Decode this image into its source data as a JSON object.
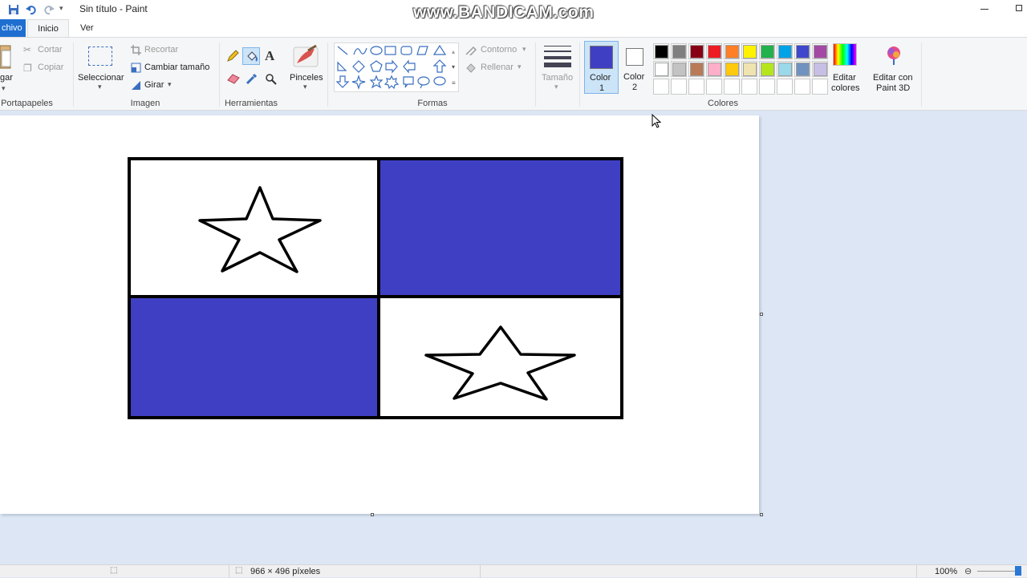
{
  "window": {
    "title": "Sin título - Paint"
  },
  "watermark": "www.BANDICAM.com",
  "tabs": {
    "file": "chivo",
    "home": "Inicio",
    "view": "Ver"
  },
  "clipboard": {
    "paste_label": "gar",
    "cut_label": "Cortar",
    "copy_label": "Copiar",
    "group_label": "Portapapeles"
  },
  "image": {
    "select_label": "Seleccionar",
    "crop_label": "Recortar",
    "resize_label": "Cambiar tamaño",
    "rotate_label": "Girar",
    "group_label": "Imagen"
  },
  "tools": {
    "group_label": "Herramientas"
  },
  "brushes": {
    "label": "Pinceles"
  },
  "shapes": {
    "outline_label": "Contorno",
    "fill_label": "Rellenar",
    "group_label": "Formas"
  },
  "size": {
    "label": "Tamaño"
  },
  "colors": {
    "color1_label": "Color",
    "color1_num": "1",
    "color2_label": "Color",
    "color2_num": "2",
    "edit_label_1": "Editar",
    "edit_label_2": "colores",
    "paint3d_label_1": "Editar con",
    "paint3d_label_2": "Paint 3D",
    "group_label": "Colores",
    "color1_value": "#3f3fc4",
    "color2_value": "#ffffff",
    "palette_row1": [
      "#000000",
      "#7f7f7f",
      "#880015",
      "#ed1c24",
      "#ff7f27",
      "#fff200",
      "#22b14c",
      "#00a2e8",
      "#3f48cc",
      "#a349a4"
    ],
    "palette_row2": [
      "#ffffff",
      "#c3c3c3",
      "#b97a57",
      "#ffaec9",
      "#ffc90e",
      "#efe4b0",
      "#b5e61d",
      "#99d9ea",
      "#7092be",
      "#c8bfe7"
    ]
  },
  "flag": {
    "blue": "#3f3fc4",
    "border": "#000000"
  },
  "statusbar": {
    "dimensions": "966 × 496 píxeles",
    "zoom": "100%"
  }
}
